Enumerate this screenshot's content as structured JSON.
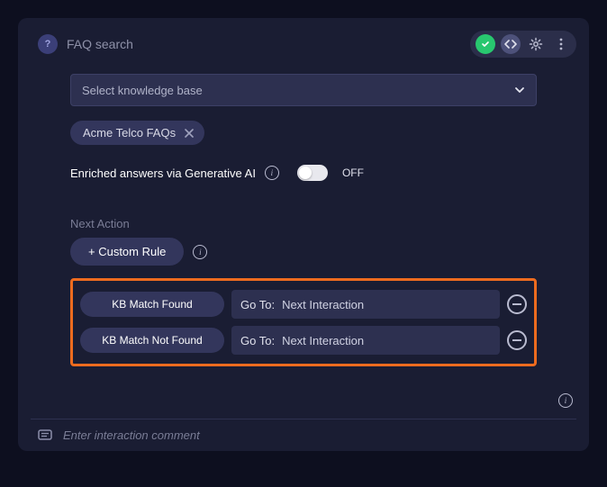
{
  "header": {
    "title": "FAQ search"
  },
  "kb_select": {
    "placeholder": "Select knowledge base"
  },
  "kb_chip": {
    "label": "Acme Telco FAQs"
  },
  "enrich": {
    "label": "Enriched answers via Generative AI",
    "state": "OFF"
  },
  "next_action": {
    "label": "Next Action",
    "custom_rule": "+ Custom Rule",
    "rules": [
      {
        "label": "KB Match Found",
        "goto": "Go To:",
        "dest": "Next Interaction"
      },
      {
        "label": "KB Match Not Found",
        "goto": "Go To:",
        "dest": "Next Interaction"
      }
    ]
  },
  "comment": {
    "placeholder": "Enter interaction comment"
  }
}
